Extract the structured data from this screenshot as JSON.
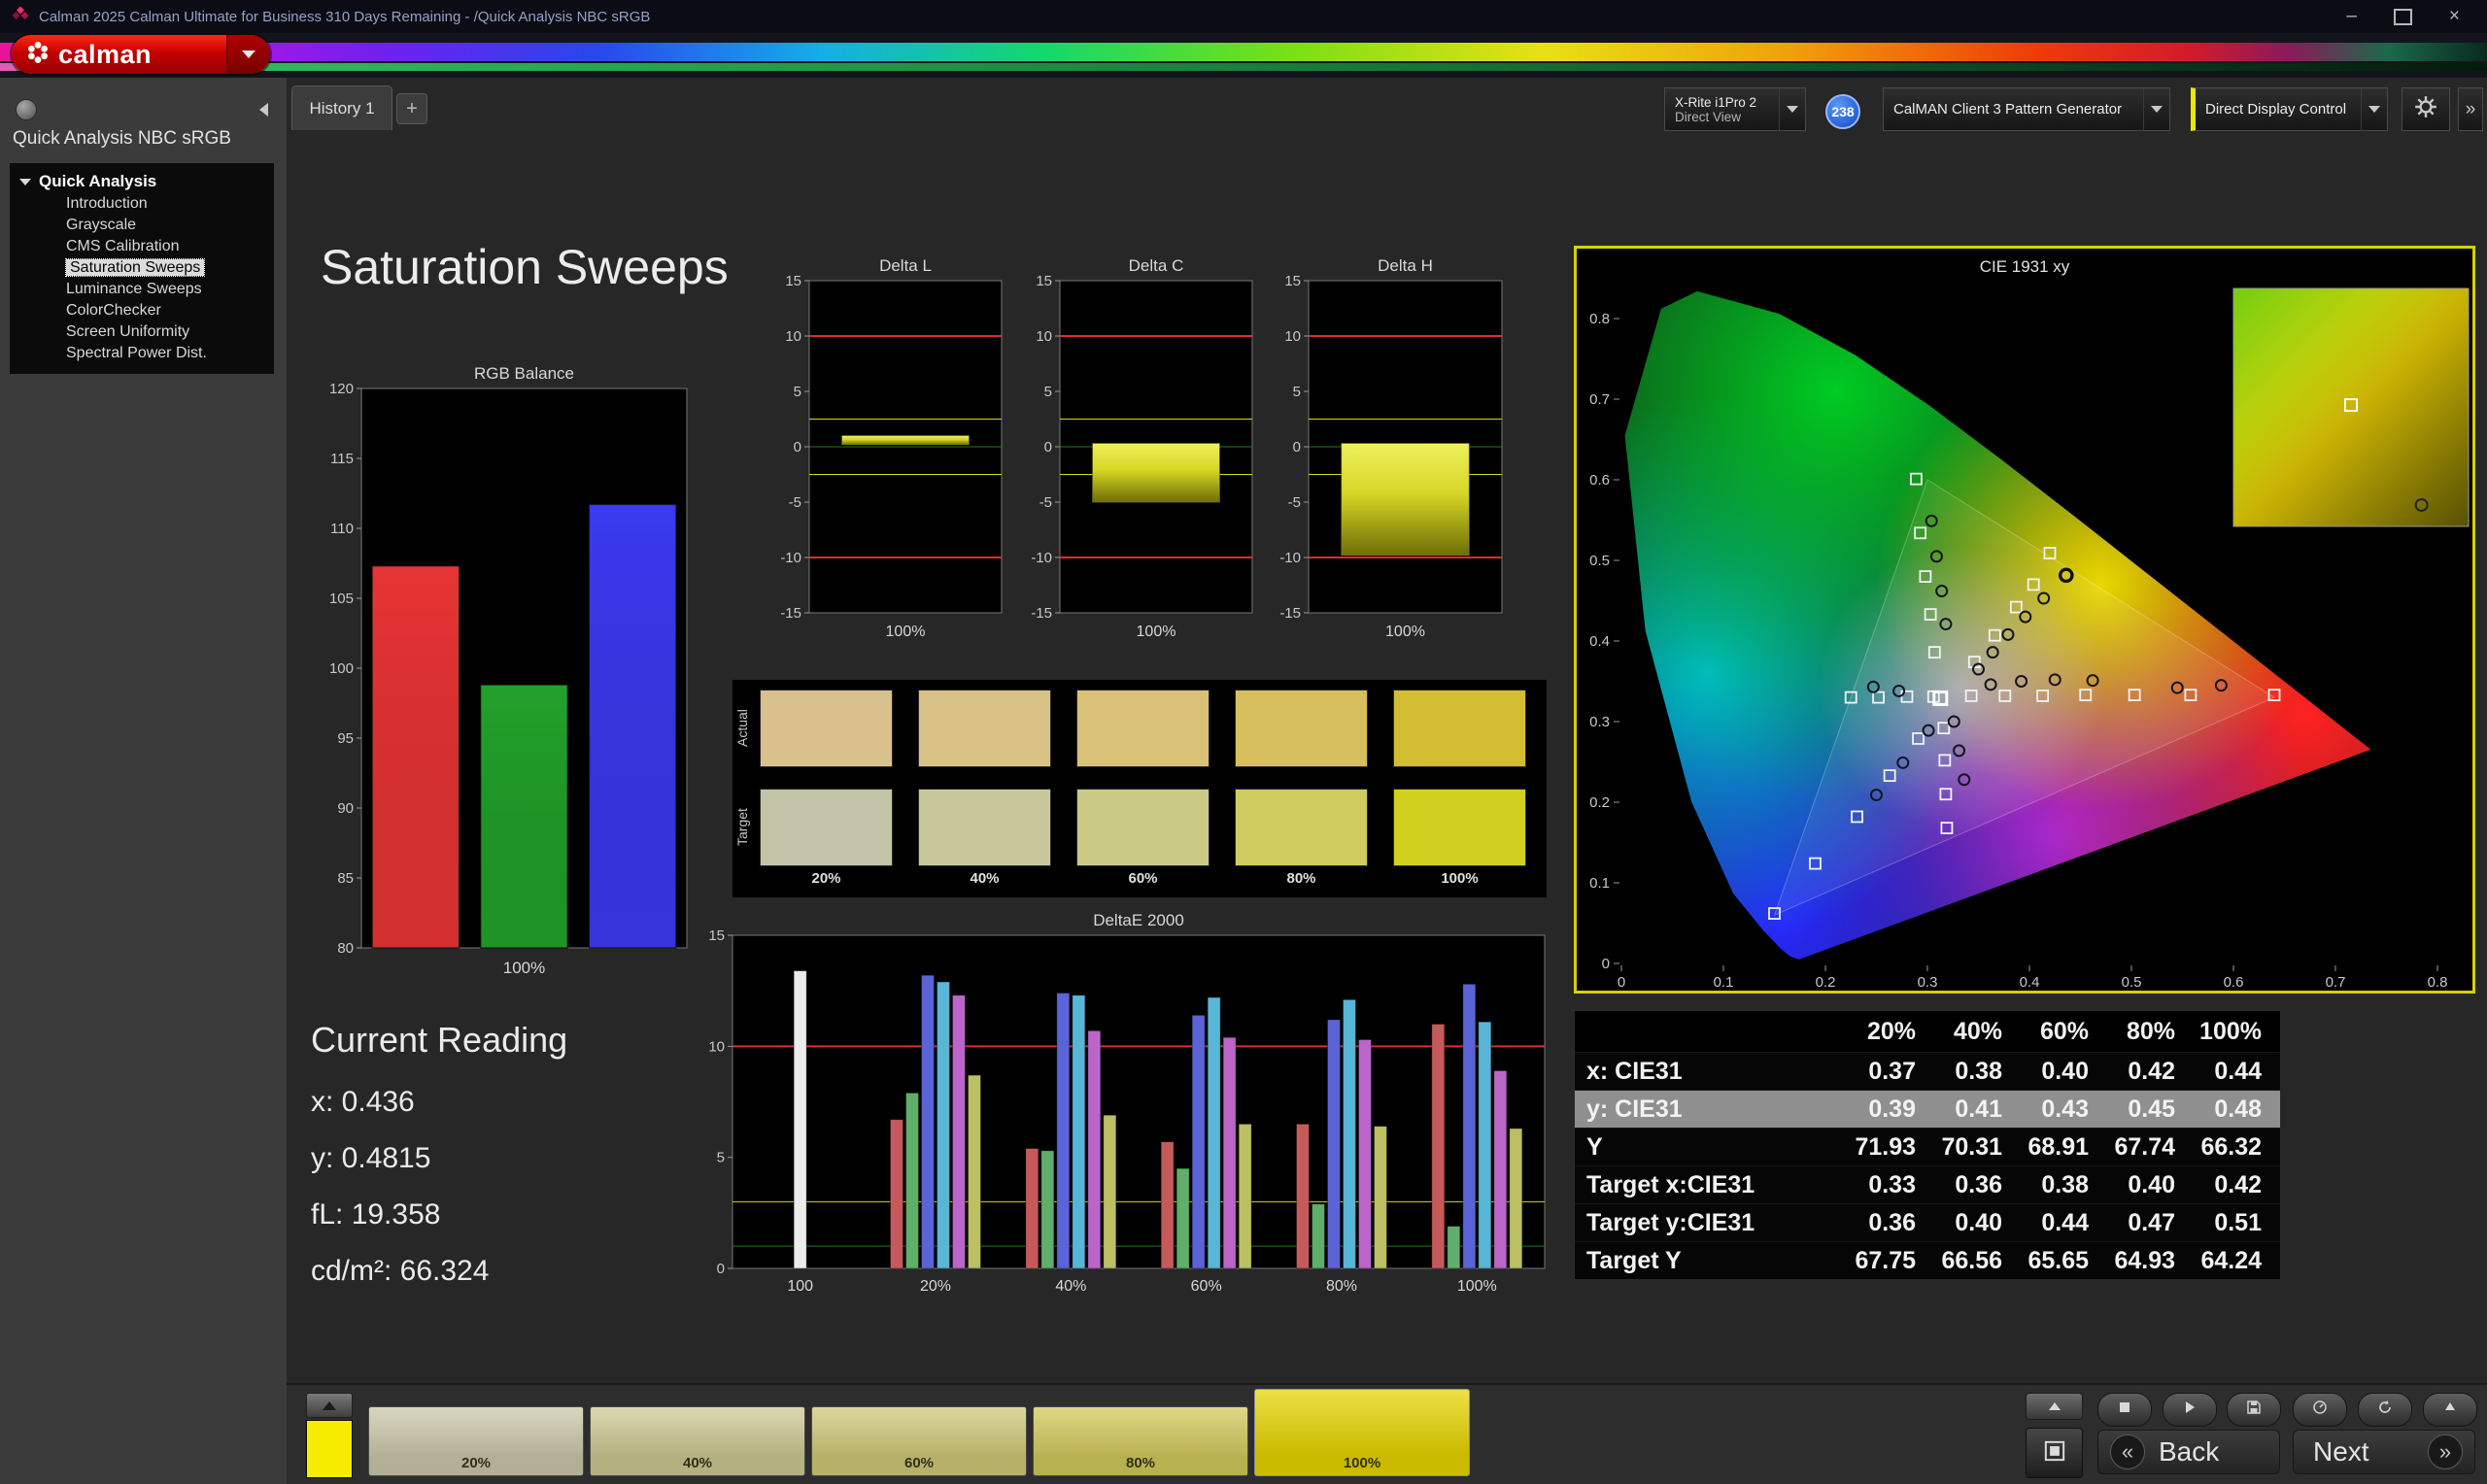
{
  "window": {
    "title": "Calman 2025 Calman Ultimate for Business 310 Days Remaining  - /Quick Analysis NBC sRGB",
    "controls": {
      "minimize": "–",
      "close": "×"
    }
  },
  "logo": {
    "text": "calman"
  },
  "sidebar": {
    "header": "Quick Analysis NBC sRGB",
    "root": "Quick Analysis",
    "items": [
      {
        "label": "Introduction",
        "selected": false
      },
      {
        "label": "Grayscale",
        "selected": false
      },
      {
        "label": "CMS Calibration",
        "selected": false
      },
      {
        "label": "Saturation Sweeps",
        "selected": true
      },
      {
        "label": "Luminance Sweeps",
        "selected": false
      },
      {
        "label": "ColorChecker",
        "selected": false
      },
      {
        "label": "Screen Uniformity",
        "selected": false
      },
      {
        "label": "Spectral Power Dist.",
        "selected": false
      }
    ]
  },
  "tabs": {
    "history": "History 1",
    "add": "+"
  },
  "toolbar": {
    "meter_line1": "X-Rite i1Pro 2",
    "meter_line2": "Direct View",
    "badge": "238",
    "pattern_generator": "CalMAN Client 3 Pattern Generator",
    "display_control": "Direct Display Control"
  },
  "page_title": "Saturation Sweeps",
  "current_reading": {
    "heading": "Current Reading",
    "lines": [
      "x: 0.436",
      "y: 0.4815",
      "fL: 19.358",
      "cd/m²: 66.324"
    ]
  },
  "swatch_panel": {
    "row_labels": [
      "Actual",
      "Target"
    ],
    "col_labels": [
      "20%",
      "40%",
      "60%",
      "80%",
      "100%"
    ],
    "actual_colors": [
      "#d8c18d",
      "#d9c286",
      "#d9c178",
      "#d6bf5c",
      "#d2be30"
    ],
    "target_colors": [
      "#c3c3a7",
      "#c7c79a",
      "#cbca85",
      "#cfcd60",
      "#d2d01e"
    ]
  },
  "results_table": {
    "columns": [
      "20%",
      "40%",
      "60%",
      "80%",
      "100%"
    ],
    "rows": [
      {
        "label": "x: CIE31",
        "values": [
          "0.37",
          "0.38",
          "0.40",
          "0.42",
          "0.44"
        ],
        "highlight": false
      },
      {
        "label": "y: CIE31",
        "values": [
          "0.39",
          "0.41",
          "0.43",
          "0.45",
          "0.48"
        ],
        "highlight": true
      },
      {
        "label": "Y",
        "values": [
          "71.93",
          "70.31",
          "68.91",
          "67.74",
          "66.32"
        ],
        "highlight": false
      },
      {
        "label": "Target x:CIE31",
        "values": [
          "0.33",
          "0.36",
          "0.38",
          "0.40",
          "0.42"
        ],
        "highlight": false
      },
      {
        "label": "Target y:CIE31",
        "values": [
          "0.36",
          "0.40",
          "0.44",
          "0.47",
          "0.51"
        ],
        "highlight": false
      },
      {
        "label": "Target Y",
        "values": [
          "67.75",
          "66.56",
          "65.65",
          "64.93",
          "64.24"
        ],
        "highlight": false
      }
    ]
  },
  "bottom_bar": {
    "swatches": [
      {
        "label": "20%",
        "color": "#cbc7a9",
        "selected": false
      },
      {
        "label": "40%",
        "color": "#cdc892",
        "selected": false
      },
      {
        "label": "60%",
        "color": "#cfc878",
        "selected": false
      },
      {
        "label": "80%",
        "color": "#d2c95a",
        "selected": false
      },
      {
        "label": "100%",
        "color": "#e6d400",
        "selected": true
      }
    ],
    "current_swatch_color": "#f6ec00",
    "back_icon": "«",
    "next_icon": "»",
    "back_label": "Back",
    "next_label": "Next"
  },
  "chart_data": [
    {
      "id": "rgb_balance",
      "type": "bar",
      "title": "RGB Balance",
      "categories": [
        "Red",
        "Green",
        "Blue"
      ],
      "values": [
        107.3,
        98.8,
        111.7
      ],
      "colors": [
        "#e83434",
        "#22a22a",
        "#3a3af0"
      ],
      "ylim": [
        80,
        120
      ],
      "ytick_step": 5,
      "xlabel": "100%"
    },
    {
      "id": "delta_l",
      "type": "delta_bar",
      "title": "Delta L",
      "ylim": [
        -15,
        15
      ],
      "ytick_step": 5,
      "xlabel": "100%",
      "bar": [
        0.2,
        1.0
      ],
      "ref_lines": [
        {
          "y": 0,
          "color": "#1f7a1f",
          "w": 1
        },
        {
          "y": 2.5,
          "color": "#d8d818",
          "w": 1
        },
        {
          "y": -2.5,
          "color": "#d8d818",
          "w": 1
        },
        {
          "y": 10,
          "color": "#d83030",
          "w": 2
        },
        {
          "y": -10,
          "color": "#d83030",
          "w": 2
        }
      ]
    },
    {
      "id": "delta_c",
      "type": "delta_bar",
      "title": "Delta C",
      "ylim": [
        -15,
        15
      ],
      "ytick_step": 5,
      "xlabel": "100%",
      "bar": [
        -5.0,
        0.3
      ],
      "ref_lines": [
        {
          "y": 0,
          "color": "#1f7a1f",
          "w": 1
        },
        {
          "y": 2.5,
          "color": "#d8d818",
          "w": 1
        },
        {
          "y": -2.5,
          "color": "#d8d818",
          "w": 1
        },
        {
          "y": 10,
          "color": "#d83030",
          "w": 2
        },
        {
          "y": -10,
          "color": "#d83030",
          "w": 2
        }
      ]
    },
    {
      "id": "delta_h",
      "type": "delta_bar",
      "title": "Delta H",
      "ylim": [
        -15,
        15
      ],
      "ytick_step": 5,
      "xlabel": "100%",
      "bar": [
        -9.8,
        0.3
      ],
      "ref_lines": [
        {
          "y": 0,
          "color": "#1f7a1f",
          "w": 1
        },
        {
          "y": 2.5,
          "color": "#d8d818",
          "w": 1
        },
        {
          "y": -2.5,
          "color": "#d8d818",
          "w": 1
        },
        {
          "y": 10,
          "color": "#d83030",
          "w": 2
        },
        {
          "y": -10,
          "color": "#d83030",
          "w": 2
        }
      ]
    },
    {
      "id": "deltae2000",
      "type": "grouped_bar",
      "title": "DeltaE 2000",
      "ylim": [
        0,
        15
      ],
      "yticks": [
        0,
        5,
        10,
        15
      ],
      "ref_lines": [
        {
          "y": 1,
          "color": "#1f7a1f",
          "w": 1
        },
        {
          "y": 3,
          "color": "#d8d818",
          "w": 1
        },
        {
          "y": 10,
          "color": "#d83030",
          "w": 2
        }
      ],
      "groups": [
        {
          "label": "100",
          "bars": [
            {
              "v": 13.4,
              "c": "#ececec"
            }
          ]
        },
        {
          "label": "20%",
          "bars": [
            {
              "v": 6.7,
              "c": "#c65a5a"
            },
            {
              "v": 7.9,
              "c": "#5fae6a"
            },
            {
              "v": 13.2,
              "c": "#5a64d6"
            },
            {
              "v": 12.9,
              "c": "#58b6d6"
            },
            {
              "v": 12.3,
              "c": "#bb65c9"
            },
            {
              "v": 8.7,
              "c": "#bcbf62"
            }
          ]
        },
        {
          "label": "40%",
          "bars": [
            {
              "v": 5.4,
              "c": "#c65a5a"
            },
            {
              "v": 5.3,
              "c": "#5fae6a"
            },
            {
              "v": 12.4,
              "c": "#5a64d6"
            },
            {
              "v": 12.3,
              "c": "#58b6d6"
            },
            {
              "v": 10.7,
              "c": "#bb65c9"
            },
            {
              "v": 6.9,
              "c": "#bcbf62"
            }
          ]
        },
        {
          "label": "60%",
          "bars": [
            {
              "v": 5.7,
              "c": "#c65a5a"
            },
            {
              "v": 4.5,
              "c": "#5fae6a"
            },
            {
              "v": 11.4,
              "c": "#5a64d6"
            },
            {
              "v": 12.2,
              "c": "#58b6d6"
            },
            {
              "v": 10.4,
              "c": "#bb65c9"
            },
            {
              "v": 6.5,
              "c": "#bcbf62"
            }
          ]
        },
        {
          "label": "80%",
          "bars": [
            {
              "v": 6.5,
              "c": "#c65a5a"
            },
            {
              "v": 2.9,
              "c": "#5fae6a"
            },
            {
              "v": 11.2,
              "c": "#5a64d6"
            },
            {
              "v": 12.1,
              "c": "#58b6d6"
            },
            {
              "v": 10.3,
              "c": "#bb65c9"
            },
            {
              "v": 6.4,
              "c": "#bcbf62"
            }
          ]
        },
        {
          "label": "100%",
          "bars": [
            {
              "v": 11.0,
              "c": "#c65a5a"
            },
            {
              "v": 1.9,
              "c": "#5fae6a"
            },
            {
              "v": 12.8,
              "c": "#5a64d6"
            },
            {
              "v": 11.1,
              "c": "#58b6d6"
            },
            {
              "v": 8.9,
              "c": "#bb65c9"
            },
            {
              "v": 6.3,
              "c": "#bcbf62"
            }
          ]
        }
      ]
    },
    {
      "id": "cie",
      "type": "scatter",
      "title": "CIE 1931 xy",
      "xlim": [
        0,
        0.8
      ],
      "ylim": [
        0,
        0.8
      ],
      "targets": [
        [
          0.225,
          0.33
        ],
        [
          0.252,
          0.33
        ],
        [
          0.28,
          0.331
        ],
        [
          0.306,
          0.331
        ],
        [
          0.343,
          0.332
        ],
        [
          0.376,
          0.332
        ],
        [
          0.413,
          0.332
        ],
        [
          0.455,
          0.333
        ],
        [
          0.503,
          0.333
        ],
        [
          0.558,
          0.333
        ],
        [
          0.64,
          0.333
        ],
        [
          0.307,
          0.386
        ],
        [
          0.303,
          0.433
        ],
        [
          0.298,
          0.48
        ],
        [
          0.293,
          0.534
        ],
        [
          0.289,
          0.601
        ],
        [
          0.291,
          0.279
        ],
        [
          0.263,
          0.233
        ],
        [
          0.231,
          0.182
        ],
        [
          0.19,
          0.124
        ],
        [
          0.15,
          0.062
        ],
        [
          0.316,
          0.292
        ],
        [
          0.317,
          0.252
        ],
        [
          0.318,
          0.21
        ],
        [
          0.319,
          0.168
        ],
        [
          0.346,
          0.374
        ],
        [
          0.366,
          0.407
        ],
        [
          0.387,
          0.442
        ],
        [
          0.404,
          0.47
        ],
        [
          0.42,
          0.509
        ]
      ],
      "measurements": [
        [
          0.35,
          0.365
        ],
        [
          0.364,
          0.386
        ],
        [
          0.379,
          0.408
        ],
        [
          0.396,
          0.43
        ],
        [
          0.414,
          0.453
        ],
        [
          0.436,
          0.4815
        ],
        [
          0.318,
          0.421
        ],
        [
          0.314,
          0.462
        ],
        [
          0.309,
          0.505
        ],
        [
          0.304,
          0.549
        ],
        [
          0.362,
          0.346
        ],
        [
          0.392,
          0.35
        ],
        [
          0.425,
          0.352
        ],
        [
          0.462,
          0.351
        ],
        [
          0.545,
          0.342
        ],
        [
          0.588,
          0.345
        ],
        [
          0.326,
          0.3
        ],
        [
          0.331,
          0.264
        ],
        [
          0.336,
          0.228
        ],
        [
          0.301,
          0.289
        ],
        [
          0.276,
          0.249
        ],
        [
          0.25,
          0.209
        ],
        [
          0.272,
          0.338
        ],
        [
          0.247,
          0.343
        ]
      ],
      "white_point": [
        0.3127,
        0.329
      ],
      "current": [
        0.436,
        0.4815
      ],
      "inset_markers": {
        "square": [
          0.5,
          0.49
        ],
        "circle": [
          0.8,
          0.91
        ]
      }
    }
  ]
}
